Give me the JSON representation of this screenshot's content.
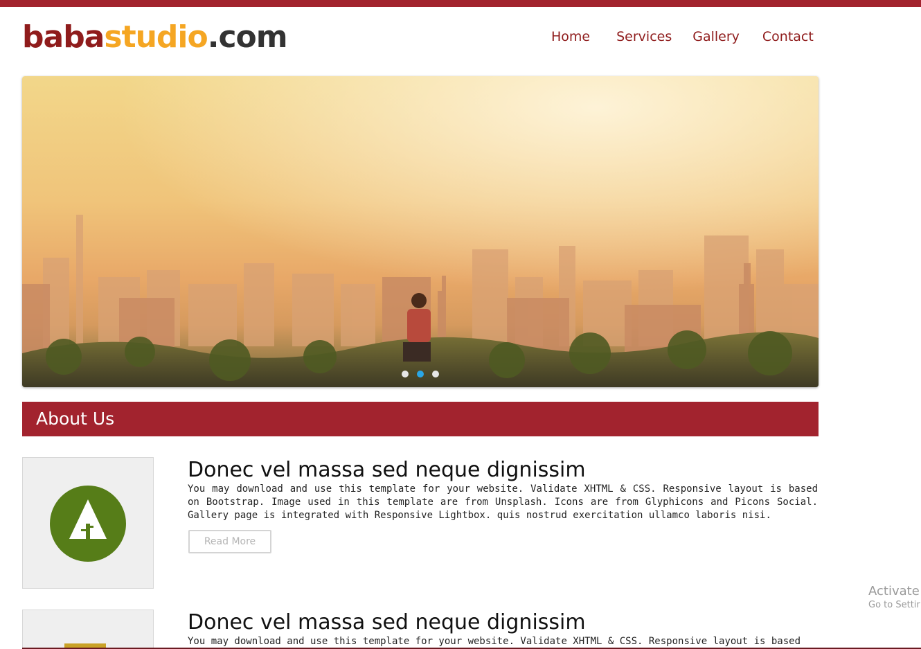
{
  "brand": {
    "part1": "baba",
    "part2": "studio",
    "part3": ".com",
    "colors": {
      "part1": "#8f1c1c",
      "part2": "#f5a623",
      "part3": "#333333"
    }
  },
  "nav": {
    "items": [
      {
        "label": "Home"
      },
      {
        "label": "Services"
      },
      {
        "label": "Gallery"
      },
      {
        "label": "Contact"
      }
    ]
  },
  "slider": {
    "slide_count": 3,
    "active_index": 1
  },
  "about": {
    "title": "About Us",
    "items": [
      {
        "heading": "Donec vel massa sed neque dignissim",
        "text": "You may download and use this template for your website. Validate XHTML & CSS. Responsive layout is based on Bootstrap. Image used in this template are from Unsplash. Icons are from Glyphicons and Picons Social. Gallery page is integrated with Responsive Lightbox. quis nostrud exercitation ullamco laboris nisi.",
        "button": "Read More",
        "icon": "forrst-tree-icon"
      },
      {
        "heading": "Donec vel massa sed neque dignissim",
        "text": "You may download and use this template for your website. Validate XHTML & CSS. Responsive layout is based",
        "icon": "html-badge-icon"
      }
    ]
  },
  "watermark": {
    "line1": "Activate",
    "line2": "Go to Settir"
  },
  "theme": {
    "accent": "#a2232e",
    "dot_active": "#2aa6e6"
  }
}
